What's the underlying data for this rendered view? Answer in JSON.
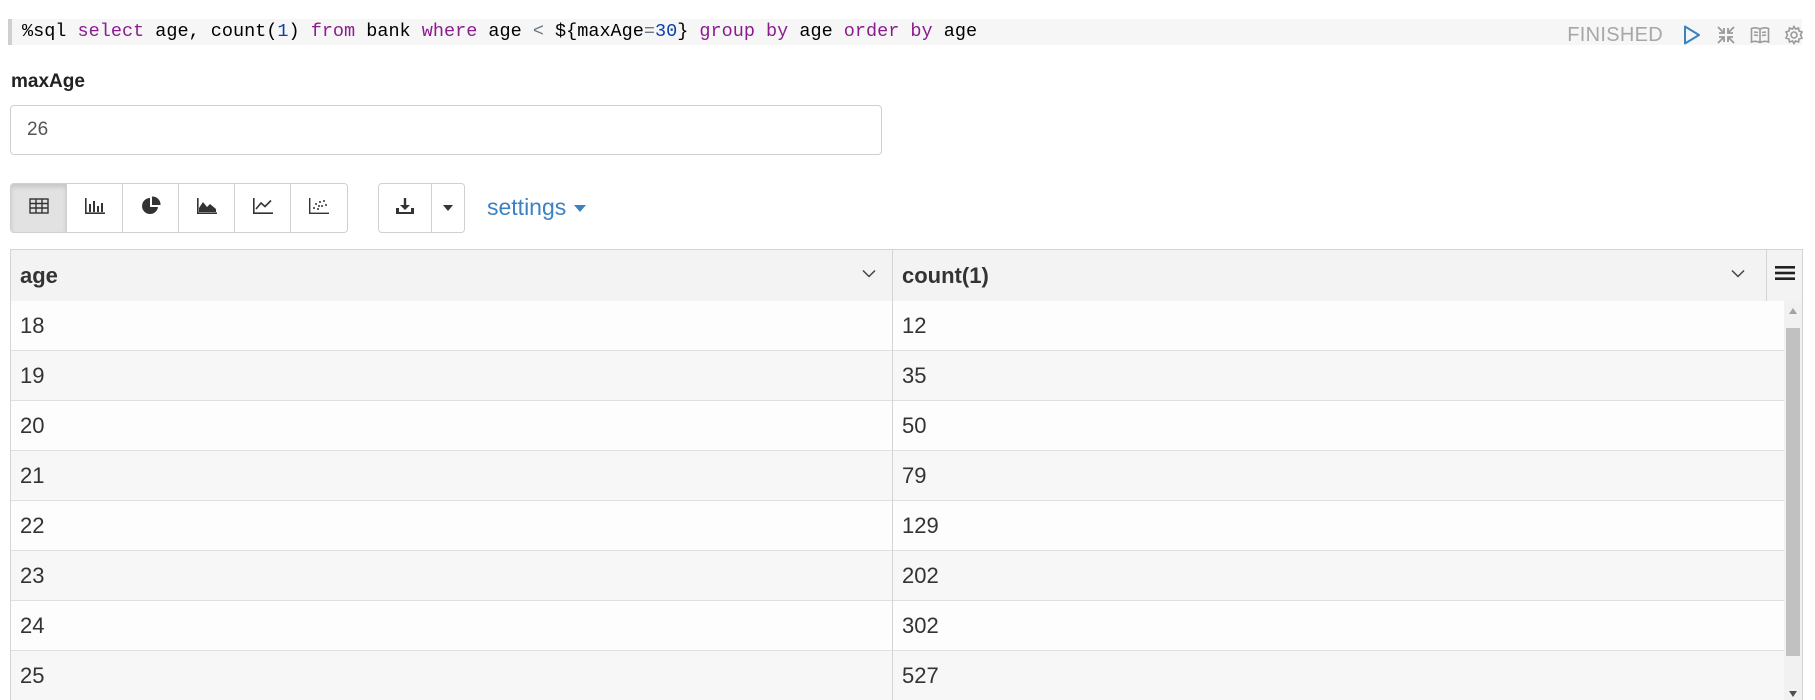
{
  "paragraph": {
    "code": {
      "interpreter": "%sql",
      "kw_select": "select",
      "cols": "age, count(",
      "num_1": "1",
      "close_paren": ")",
      "kw_from": "from",
      "table": "bank",
      "kw_where": "where",
      "where_col": "age",
      "lt": "<",
      "dyn_open": "${maxAge",
      "eq": "=",
      "num_30": "30",
      "dyn_close": "}",
      "kw_group": "group",
      "kw_by": "by",
      "group_col": "age",
      "kw_order": "order",
      "kw_by2": "by",
      "order_col": "age"
    },
    "status": "FINISHED",
    "controls": [
      "run-icon",
      "collapse-icon",
      "book-icon",
      "gear-icon"
    ]
  },
  "form": {
    "param_label": "maxAge",
    "param_value": "26"
  },
  "toolbar": {
    "visualizations": [
      "table-icon",
      "bar-chart-icon",
      "pie-chart-icon",
      "area-chart-icon",
      "line-chart-icon",
      "scatter-chart-icon"
    ],
    "active": "table",
    "download_icon": "download-icon",
    "settings_label": "settings"
  },
  "table": {
    "columns": [
      "age",
      "count(1)"
    ],
    "rows": [
      [
        "18",
        "12"
      ],
      [
        "19",
        "35"
      ],
      [
        "20",
        "50"
      ],
      [
        "21",
        "79"
      ],
      [
        "22",
        "129"
      ],
      [
        "23",
        "202"
      ],
      [
        "24",
        "302"
      ],
      [
        "25",
        "527"
      ]
    ]
  },
  "colors": {
    "keyword": "#8a1c8f",
    "number": "#0b3fa8",
    "link": "#3b82c4",
    "status": "#a7a7a7"
  }
}
